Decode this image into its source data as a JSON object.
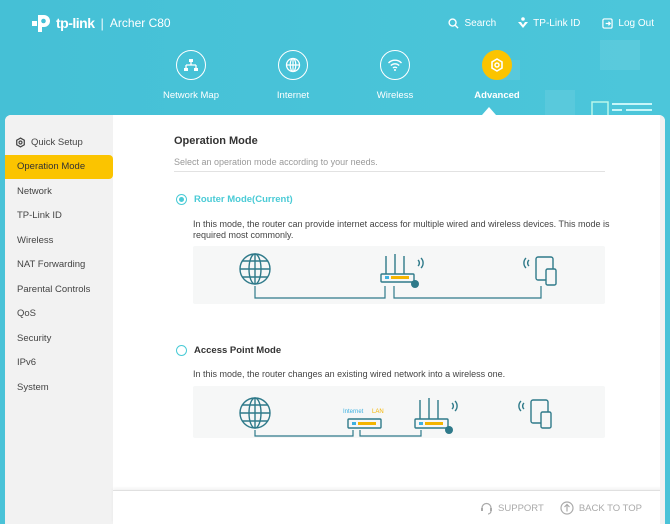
{
  "header": {
    "brand": "tp-link",
    "separator": "|",
    "model": "Archer C80",
    "links": [
      {
        "label": "Search",
        "icon": "search-icon"
      },
      {
        "label": "TP-Link ID",
        "icon": "tplink-id-icon"
      },
      {
        "label": "Log Out",
        "icon": "logout-icon"
      }
    ]
  },
  "nav": {
    "tabs": [
      {
        "label": "Network Map",
        "icon": "network-map-icon",
        "active": false
      },
      {
        "label": "Internet",
        "icon": "globe-icon",
        "active": false
      },
      {
        "label": "Wireless",
        "icon": "wifi-icon",
        "active": false
      },
      {
        "label": "Advanced",
        "icon": "gear-icon",
        "active": true
      }
    ]
  },
  "sidebar": {
    "items": [
      {
        "label": "Quick Setup",
        "icon": "gear-icon"
      },
      {
        "label": "Operation Mode",
        "active": true
      },
      {
        "label": "Network"
      },
      {
        "label": "TP-Link ID"
      },
      {
        "label": "Wireless"
      },
      {
        "label": "NAT Forwarding"
      },
      {
        "label": "Parental Controls"
      },
      {
        "label": "QoS"
      },
      {
        "label": "Security"
      },
      {
        "label": "IPv6"
      },
      {
        "label": "System"
      }
    ]
  },
  "main": {
    "title": "Operation Mode",
    "subtitle": "Select an operation mode according to your needs.",
    "modes": [
      {
        "label": "Router Mode(Current)",
        "selected": true,
        "description": "In this mode, the router can provide internet access for multiple wired and wireless devices. This mode is required most commonly."
      },
      {
        "label": "Access Point Mode",
        "selected": false,
        "description": "In this mode, the router changes an existing wired network into a wireless one.",
        "diagram_labels": {
          "internet": "Internet",
          "lan": "LAN"
        }
      }
    ]
  },
  "footer": {
    "support": "SUPPORT",
    "back_to_top": "BACK TO TOP"
  },
  "colors": {
    "header_bg": "#4ac3d8",
    "accent_yellow": "#fbc400",
    "accent_teal": "#4acbd6",
    "diagram_stroke": "#2f7a8a"
  }
}
